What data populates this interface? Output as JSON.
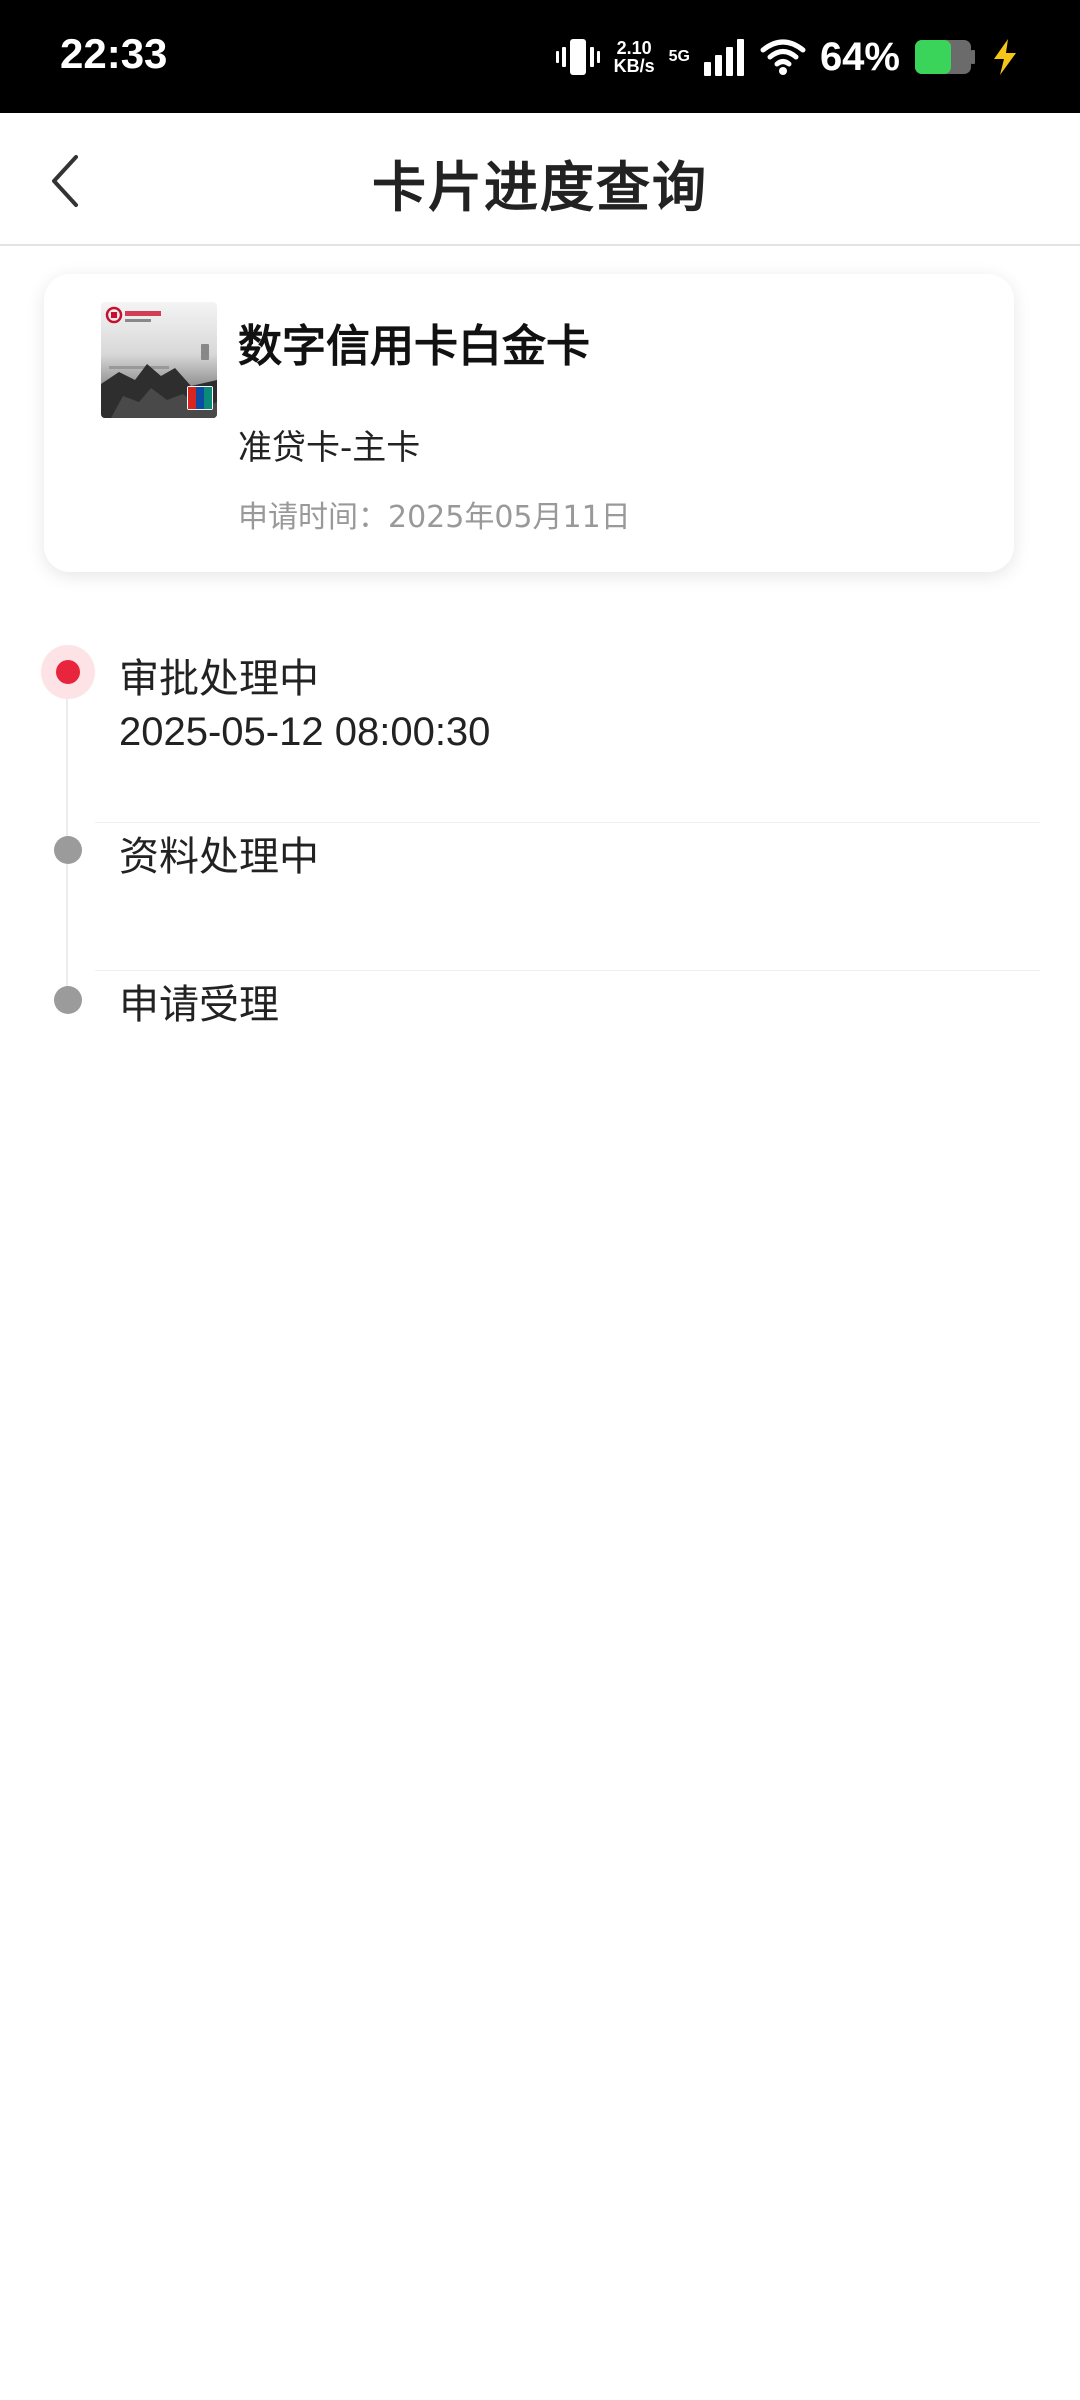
{
  "status_bar": {
    "time": "22:33",
    "net_speed_value": "2.10",
    "net_speed_unit": "KB/s",
    "net_type": "5G",
    "battery_percent": "64%",
    "battery_level": 0.64,
    "icons": [
      "vibrate-icon",
      "signal-icon",
      "wifi-icon",
      "battery-icon",
      "charging-icon"
    ]
  },
  "header": {
    "title": "卡片进度查询",
    "back_icon": "chevron-left-icon"
  },
  "card": {
    "name": "数字信用卡白金卡",
    "type": "准贷卡-主卡",
    "apply_time": "申请时间：2025年05月11日"
  },
  "timeline": [
    {
      "label": "审批处理中",
      "time": "2025-05-12 08:00:30",
      "status": "active"
    },
    {
      "label": "资料处理中",
      "time": "",
      "status": "pending"
    },
    {
      "label": "申请受理",
      "time": "",
      "status": "pending"
    }
  ],
  "colors": {
    "accent": "#e8253c",
    "accent_light": "#fde3e6",
    "pending_dot": "#9b9b9b",
    "secondary_text": "#999999",
    "battery_green": "#3ad45a",
    "charge_yellow": "#f5c518"
  }
}
